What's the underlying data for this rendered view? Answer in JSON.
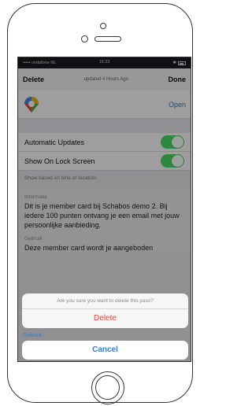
{
  "status_bar": {
    "carrier": "••••• vodafone NL",
    "time": "16:33"
  },
  "nav": {
    "left": "Delete",
    "title": "updated 4 Hours Ago",
    "right": "Done"
  },
  "pass": {
    "name": "",
    "open_label": "Open"
  },
  "settings": [
    {
      "label": "Automatic Updates",
      "on": true
    },
    {
      "label": "Show On Lock Screen",
      "on": true
    }
  ],
  "settings_hint": "Show based on time or location.",
  "info": {
    "heading": "Informatie",
    "body": "Dit is je member card bij Schabos demo 2. Bij iedere 100 punten ontvang je een email met jouw persoonlijke aanbieding."
  },
  "usage": {
    "heading": "Gebruik",
    "body": "Deze member card wordt je aangeboden"
  },
  "usage2_heading": "Gebruik",
  "action_sheet": {
    "message": "Are you sure you want to delete this pass?",
    "delete_label": "Delete",
    "cancel_label": "Cancel"
  },
  "colors": {
    "accent": "#2f7dd8",
    "destructive": "#ff3b30",
    "toggle_on": "#4cd964"
  }
}
